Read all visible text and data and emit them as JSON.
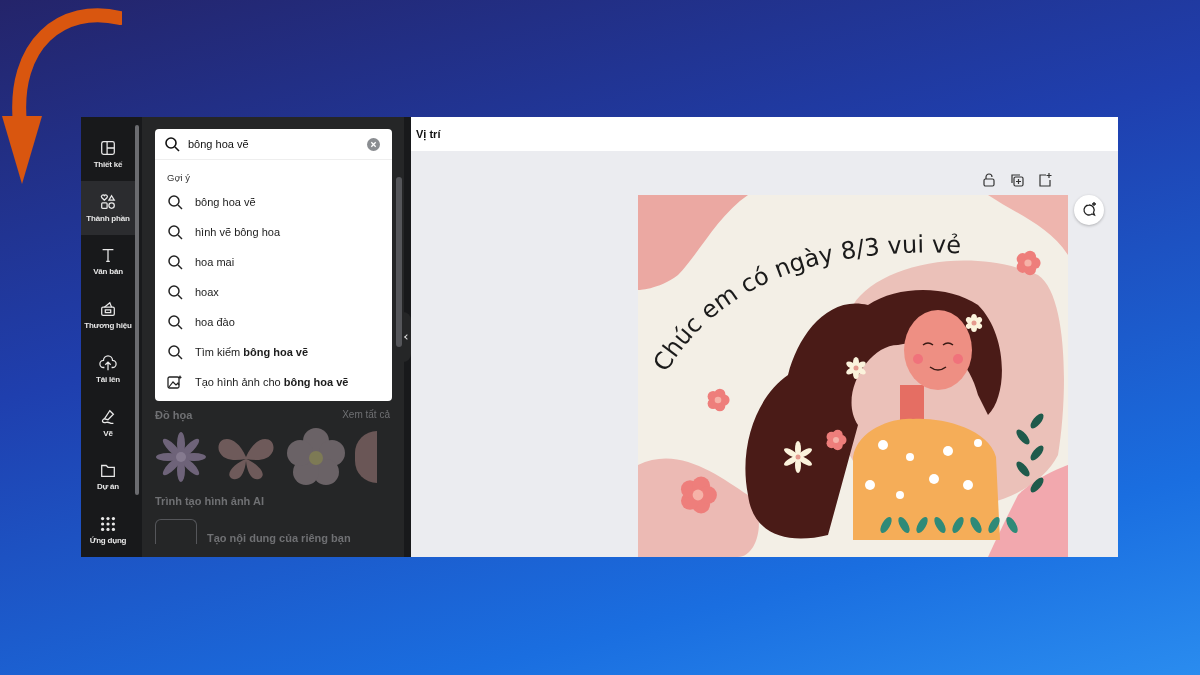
{
  "sidebar": {
    "items": [
      {
        "kind": "layout",
        "label": "Thiết kế",
        "selected": false
      },
      {
        "kind": "elements",
        "label": "Thành phần",
        "selected": true
      },
      {
        "kind": "text",
        "label": "Văn bản",
        "selected": false
      },
      {
        "kind": "brand",
        "label": "Thương hiệu",
        "selected": false
      },
      {
        "kind": "upload",
        "label": "Tải lên",
        "selected": false
      },
      {
        "kind": "draw",
        "label": "Vẽ",
        "selected": false
      },
      {
        "kind": "projects",
        "label": "Dự án",
        "selected": false
      },
      {
        "kind": "apps",
        "label": "Ứng dụng",
        "selected": false
      }
    ]
  },
  "search": {
    "value": "bông hoa vẽ"
  },
  "suggestions": {
    "heading": "Gợi ý",
    "items": [
      {
        "kind": "search",
        "text": "bông hoa vẽ"
      },
      {
        "kind": "search",
        "text": "hình vẽ bông hoa"
      },
      {
        "kind": "search",
        "text": "hoa mai"
      },
      {
        "kind": "search",
        "text": "hoax"
      },
      {
        "kind": "search",
        "text": "hoa đào"
      },
      {
        "kind": "search",
        "text": "Tìm kiếm **bông hoa vẽ**"
      },
      {
        "kind": "generate",
        "text": "Tạo hình ảnh cho **bông hoa vẽ**"
      }
    ]
  },
  "panel": {
    "graphics_heading": "Đồ họa",
    "see_all": "Xem tất cả",
    "ai_heading": "Trình tạo hình ảnh AI",
    "ai_item": "Tạo nội dung của riêng bạn"
  },
  "toolbar": {
    "title": "Vị trí"
  },
  "design": {
    "greeting": "Chúc em có ngày 8/3 vui vẻ"
  }
}
